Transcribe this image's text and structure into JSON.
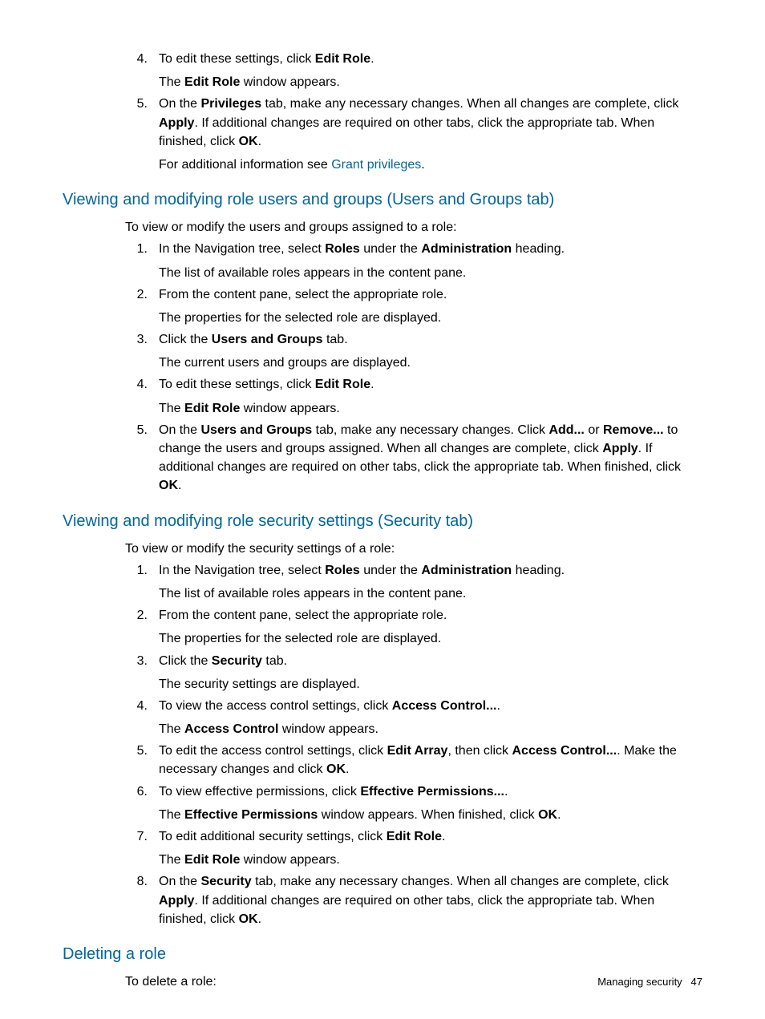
{
  "top": {
    "items": [
      {
        "num": "4.",
        "main_html": "To edit these settings, click <b>Edit Role</b>.",
        "sub_html": "The <b>Edit Role</b> window appears."
      },
      {
        "num": "5.",
        "main_html": "On the <b>Privileges</b> tab, make any necessary changes. When all changes are complete, click <b>Apply</b>. If additional changes are required on other tabs, click the appropriate tab. When finished, click <b>OK</b>.",
        "sub_html": "For additional information see <span class='link'>Grant privileges</span>."
      }
    ]
  },
  "heading1": "Viewing and modifying role users and groups (Users and Groups tab)",
  "intro1": "To view or modify the users and groups assigned to a role:",
  "section1": {
    "items": [
      {
        "num": "1.",
        "main_html": "In the Navigation tree, select <b>Roles</b> under the <b>Administration</b> heading.",
        "sub_html": "The list of available roles appears in the content pane."
      },
      {
        "num": "2.",
        "main_html": "From the content pane, select the appropriate role.",
        "sub_html": "The properties for the selected role are displayed."
      },
      {
        "num": "3.",
        "main_html": "Click the <b>Users and Groups</b> tab.",
        "sub_html": "The current users and groups are displayed."
      },
      {
        "num": "4.",
        "main_html": "To edit these settings, click <b>Edit Role</b>.",
        "sub_html": "The <b>Edit Role</b> window appears."
      },
      {
        "num": "5.",
        "main_html": "On the <b>Users and Groups</b> tab, make any necessary changes. Click <b>Add...</b> or <b>Remove...</b> to change the users and groups assigned. When all changes are complete, click <b>Apply</b>. If additional changes are required on other tabs, click the appropriate tab. When finished, click <b>OK</b>.",
        "sub_html": ""
      }
    ]
  },
  "heading2": "Viewing and modifying role security settings (Security tab)",
  "intro2": "To view or modify the security settings of a role:",
  "section2": {
    "items": [
      {
        "num": "1.",
        "main_html": "In the Navigation tree, select <b>Roles</b> under the <b>Administration</b> heading.",
        "sub_html": "The list of available roles appears in the content pane."
      },
      {
        "num": "2.",
        "main_html": "From the content pane, select the appropriate role.",
        "sub_html": "The properties for the selected role are displayed."
      },
      {
        "num": "3.",
        "main_html": "Click the <b>Security</b> tab.",
        "sub_html": "The security settings are displayed."
      },
      {
        "num": "4.",
        "main_html": "To view the access control settings, click <b>Access Control...</b>.",
        "sub_html": "The <b>Access Control</b> window appears."
      },
      {
        "num": "5.",
        "main_html": "To edit the access control settings, click <b>Edit Array</b>, then click <b>Access Control...</b>. Make the necessary changes and click <b>OK</b>.",
        "sub_html": ""
      },
      {
        "num": "6.",
        "main_html": "To view effective permissions, click <b>Effective Permissions...</b>.",
        "sub_html": "The <b>Effective Permissions</b> window appears. When finished, click <b>OK</b>."
      },
      {
        "num": "7.",
        "main_html": "To edit additional security settings, click <b>Edit Role</b>.",
        "sub_html": "The <b>Edit Role</b> window appears."
      },
      {
        "num": "8.",
        "main_html": "On the <b>Security</b> tab, make any necessary changes. When all changes are complete, click <b>Apply</b>. If additional changes are required on other tabs, click the appropriate tab. When finished, click <b>OK</b>.",
        "sub_html": ""
      }
    ]
  },
  "heading3": "Deleting a role",
  "intro3": "To delete a role:",
  "footer_text": "Managing security",
  "footer_page": "47"
}
